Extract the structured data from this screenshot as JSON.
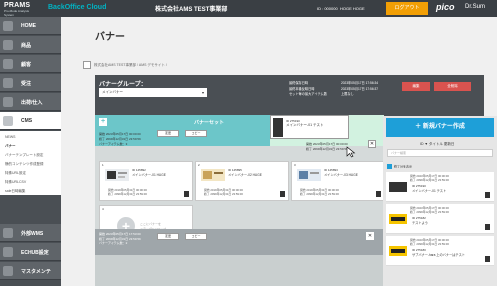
{
  "topbar": {
    "logo_main": "PRAMS",
    "logo_sub": "Pro-Mode Analysis System",
    "product": "BackOffice Cloud",
    "company": "株式会社AMS TEST事業部",
    "user_id": "ID : 000000",
    "user_name": "HOGE HOGE",
    "logout": "ログアウト",
    "pico": "pico",
    "drsum": "Dr.Sum"
  },
  "sidebar": {
    "items": [
      {
        "label": "HOME"
      },
      {
        "label": "商品"
      },
      {
        "label": "顧客"
      },
      {
        "label": "受注"
      },
      {
        "label": "出荷/仕入"
      },
      {
        "label": "CMS"
      },
      {
        "label": "外部WMS"
      },
      {
        "label": "ECHUB設定"
      },
      {
        "label": "マスタメンテ"
      }
    ],
    "cms_sub": [
      "NEWS",
      "バナー",
      "バナーテンプレート設定",
      "静的コンテンツ作成登録",
      "特殊URL設定",
      "特殊URLCSV",
      "sale日時編集"
    ]
  },
  "main": {
    "title": "バナー",
    "breadcrumb": "株式会社AMS TEST事業部 / AMS デモサイト /",
    "group_label": "バナーグループ：",
    "group_value": "メインバナー",
    "meta": {
      "l1": "最終保存日時",
      "l2": "最終本番反映日時",
      "l3": "セット毎の最大アイテム数",
      "v1": "2023年05月17日 17:56:34",
      "v2": "2023年05月17日 17:56:37",
      "v3": "上限なし"
    },
    "edit_btn": "編集",
    "delete_btn": "全削除",
    "set": {
      "title": "バナーセット",
      "start": "開始 2023年05月17日 00:00:00",
      "end": "終了 2099年12月31日 23:59:59",
      "count": "バナーアイテム数：3",
      "change_btn": "変更",
      "copy_btn": "コピー"
    },
    "drag": {
      "id": "ID 275190",
      "name": "メインバナー-01 テスト",
      "start": "開始 2023年05月17日 00:00:00",
      "end": "終了 2099年12月31日 23:59:59"
    },
    "cards": [
      {
        "num": "1",
        "id": "ID 145892",
        "name": "メインバナー-01 HUGE",
        "start": "開始 2019年05月31日 00:00:00",
        "end": "終了 2099年12月31日 23:59:00"
      },
      {
        "num": "2",
        "id": "ID 145895",
        "name": "メインバナー-02 HUGE",
        "start": "開始 2019年05月31日 00:00:00",
        "end": "終了 2099年12月31日 23:59:00"
      },
      {
        "num": "3",
        "id": "ID 145893",
        "name": "メインバナー-03 HUGE",
        "start": "開始 2019年05月31日 00:00:00",
        "end": "終了 2099年12月31日 23:59:00"
      }
    ],
    "empty_card": {
      "num": "4",
      "line1": "ここにバナーを",
      "line2": "ドラッグ&ドロップ"
    },
    "set2": {
      "start": "開始 2023年05月17日 17:53:00",
      "end": "終了 2099年12月31日 23:59:59",
      "count": "バナーアイテム数：2",
      "change_btn": "変更",
      "copy_btn": "コピー"
    }
  },
  "right_panel": {
    "new_btn": "新規バナー作成",
    "filter_tabs": "ID ▼ タイトル 更新日",
    "search_placeholder": "バナー検索",
    "check_label": "終了分を表示",
    "items": [
      {
        "start": "開始 2023年05月17日 00:00:00",
        "end": "終了 2099年12月31日 23:59:00",
        "id": "ID 275190",
        "name": "メインバナー-01 テスト"
      },
      {
        "start": "開始 2023年05月17日 00:00:00",
        "end": "終了 2099年12月31日 23:59:00",
        "id": "ID 275182",
        "name": "テストよう"
      },
      {
        "start": "開始 2023年05月17日 00:00:00",
        "end": "終了 2099年12月31日 23:59:00",
        "id": "ID 275180",
        "name": "サブバナー-hara 上のバナーはテスト"
      }
    ]
  },
  "colors": {
    "accent": "#1e9fd8",
    "set_header": "#6cc6c9",
    "logout": "#f29f05",
    "danger": "#d9534f"
  }
}
